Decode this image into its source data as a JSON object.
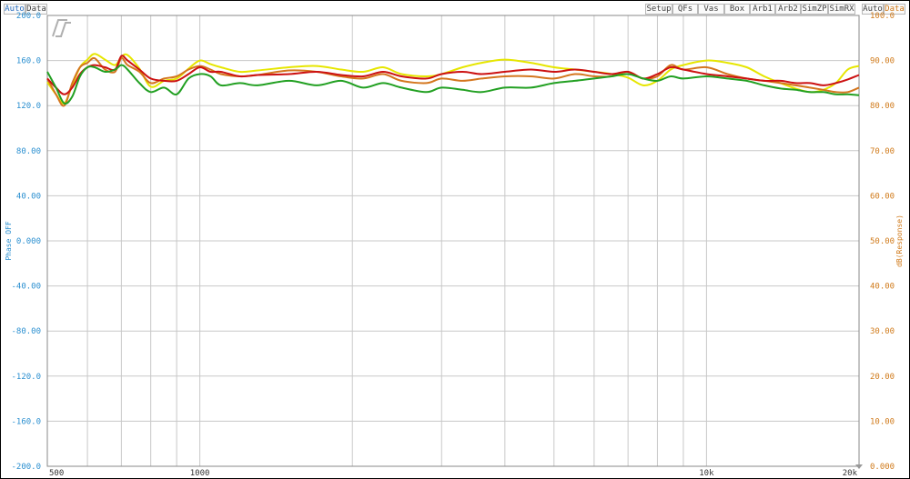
{
  "toolbar_left": [
    {
      "label": "Auto",
      "color": "#2a6fc0"
    },
    {
      "label": "Data",
      "color": "#444444"
    }
  ],
  "toolbar_right": [
    "Setup",
    "QFs",
    "Vas",
    "Box",
    "Arb1",
    "Arb2",
    "SimZP",
    "SimRX"
  ],
  "toolbar_right_axis": [
    {
      "label": "Auto",
      "color": "#444444"
    },
    {
      "label": "Data",
      "color": "#d07a1a"
    }
  ],
  "colors": {
    "left_axis": "#2a8fd0",
    "right_axis": "#d07a1a",
    "grid": "#c8c8c8",
    "bottom_labels": "#333333"
  },
  "chart_data": {
    "type": "line",
    "x_scale": "log",
    "xlim": [
      500,
      20000
    ],
    "x_tick_labels": [
      {
        "x": 500,
        "label": "500"
      },
      {
        "x": 1000,
        "label": "1000"
      },
      {
        "x": 10000,
        "label": "10k"
      },
      {
        "x": 20000,
        "label": "20k"
      }
    ],
    "x_gridlines": [
      600,
      700,
      800,
      900,
      1000,
      2000,
      3000,
      4000,
      5000,
      6000,
      7000,
      8000,
      9000,
      10000,
      20000
    ],
    "left_axis": {
      "label": "Phase OFF",
      "ylim": [
        -200,
        200
      ],
      "ticks": [
        "200.0",
        "160.0",
        "120.0",
        "80.00",
        "40.00",
        "0.000",
        "-40.00",
        "-80.00",
        "-120.0",
        "-160.0",
        "-200.0"
      ]
    },
    "right_axis": {
      "label": "dB(Response)",
      "ylim": [
        0,
        100
      ],
      "ticks": [
        "100.0",
        "90.00",
        "80.00",
        "70.00",
        "60.00",
        "50.00",
        "40.00",
        "30.00",
        "20.00",
        "10.00",
        "0.000"
      ]
    },
    "grid": true,
    "series": [
      {
        "color": "#e6e600",
        "x": [
          500,
          520,
          540,
          560,
          580,
          600,
          620,
          650,
          680,
          700,
          720,
          760,
          800,
          850,
          900,
          950,
          1000,
          1050,
          1100,
          1200,
          1300,
          1500,
          1700,
          1900,
          2100,
          2300,
          2500,
          2800,
          3000,
          3300,
          3600,
          4000,
          4500,
          5000,
          5500,
          6000,
          6500,
          7000,
          7500,
          8000,
          8500,
          9000,
          10000,
          11000,
          12000,
          13000,
          14000,
          15000,
          16000,
          17000,
          18000,
          19000,
          20000
        ],
        "y": [
          85.2,
          82.5,
          80.5,
          84.5,
          88.5,
          90.2,
          91.5,
          90.2,
          89.0,
          90.8,
          91.2,
          88.2,
          84.2,
          85.5,
          86.0,
          88.2,
          90.0,
          89.2,
          88.5,
          87.5,
          87.8,
          88.5,
          88.8,
          88.0,
          87.5,
          88.5,
          87.0,
          86.5,
          87.0,
          88.5,
          89.5,
          90.2,
          89.5,
          88.5,
          88.0,
          87.5,
          87.0,
          86.2,
          84.5,
          85.5,
          88.0,
          89.0,
          90.0,
          89.5,
          88.5,
          86.5,
          85.0,
          83.8,
          83.0,
          83.5,
          85.0,
          88.0,
          88.8
        ]
      },
      {
        "color": "#d4761e",
        "x": [
          500,
          520,
          540,
          560,
          580,
          600,
          620,
          650,
          680,
          700,
          720,
          760,
          800,
          850,
          900,
          950,
          1000,
          1050,
          1100,
          1200,
          1300,
          1500,
          1700,
          1900,
          2100,
          2300,
          2500,
          2800,
          3000,
          3300,
          3600,
          4000,
          4500,
          5000,
          5500,
          6000,
          6500,
          7000,
          7500,
          8000,
          8500,
          9000,
          10000,
          11000,
          12000,
          13000,
          14000,
          15000,
          16000,
          17000,
          18000,
          19000,
          20000
        ],
        "y": [
          86.0,
          82.5,
          80.0,
          85.0,
          88.5,
          89.5,
          90.5,
          88.0,
          87.5,
          90.5,
          89.0,
          87.5,
          85.0,
          86.0,
          86.5,
          88.0,
          88.8,
          88.0,
          87.0,
          86.5,
          86.8,
          87.8,
          87.5,
          86.5,
          86.0,
          87.0,
          85.5,
          85.0,
          86.0,
          85.5,
          86.0,
          86.5,
          86.5,
          86.0,
          87.0,
          86.5,
          86.5,
          87.5,
          86.0,
          86.5,
          89.0,
          88.0,
          88.5,
          87.0,
          86.0,
          85.5,
          85.0,
          84.5,
          84.0,
          83.5,
          83.0,
          83.0,
          84.0
        ]
      },
      {
        "color": "#cc1111",
        "x": [
          500,
          520,
          540,
          560,
          580,
          600,
          620,
          650,
          680,
          700,
          720,
          760,
          800,
          850,
          900,
          950,
          1000,
          1050,
          1100,
          1200,
          1300,
          1500,
          1700,
          1900,
          2100,
          2300,
          2500,
          2800,
          3000,
          3300,
          3600,
          4000,
          4500,
          5000,
          5500,
          6000,
          6500,
          7000,
          7500,
          8000,
          8500,
          9000,
          10000,
          11000,
          12000,
          13000,
          14000,
          15000,
          16000,
          17000,
          18000,
          19000,
          20000
        ],
        "y": [
          86.0,
          84.0,
          82.5,
          84.0,
          87.0,
          88.5,
          89.0,
          88.5,
          88.0,
          91.0,
          90.0,
          88.0,
          86.0,
          85.5,
          85.5,
          87.0,
          88.5,
          87.5,
          87.5,
          86.5,
          86.8,
          87.0,
          87.5,
          86.8,
          86.5,
          87.5,
          86.5,
          86.0,
          87.0,
          87.5,
          87.0,
          87.5,
          88.0,
          87.5,
          88.0,
          87.5,
          87.0,
          87.5,
          86.0,
          87.0,
          88.5,
          88.0,
          87.0,
          86.5,
          86.0,
          85.5,
          85.5,
          85.0,
          85.0,
          84.5,
          85.0,
          85.8,
          86.8
        ]
      },
      {
        "color": "#22a022",
        "x": [
          500,
          520,
          540,
          560,
          580,
          600,
          620,
          650,
          680,
          700,
          720,
          760,
          800,
          850,
          900,
          950,
          1000,
          1050,
          1100,
          1200,
          1300,
          1500,
          1700,
          1900,
          2100,
          2300,
          2500,
          2800,
          3000,
          3300,
          3600,
          4000,
          4500,
          5000,
          5500,
          6000,
          6500,
          7000,
          7500,
          8000,
          8500,
          9000,
          10000,
          11000,
          12000,
          13000,
          14000,
          15000,
          16000,
          17000,
          18000,
          19000,
          20000
        ],
        "y": [
          87.5,
          84.0,
          80.5,
          82.0,
          86.5,
          88.5,
          88.5,
          87.5,
          88.0,
          89.0,
          88.0,
          85.0,
          83.0,
          84.0,
          82.5,
          86.0,
          87.0,
          86.5,
          84.5,
          85.0,
          84.5,
          85.5,
          84.5,
          85.5,
          84.0,
          85.0,
          84.0,
          83.0,
          84.0,
          83.5,
          83.0,
          84.0,
          84.0,
          85.0,
          85.5,
          86.0,
          86.5,
          87.0,
          86.0,
          85.5,
          86.5,
          86.0,
          86.5,
          86.0,
          85.5,
          84.5,
          83.8,
          83.5,
          83.0,
          83.0,
          82.5,
          82.5,
          82.3
        ]
      }
    ]
  }
}
